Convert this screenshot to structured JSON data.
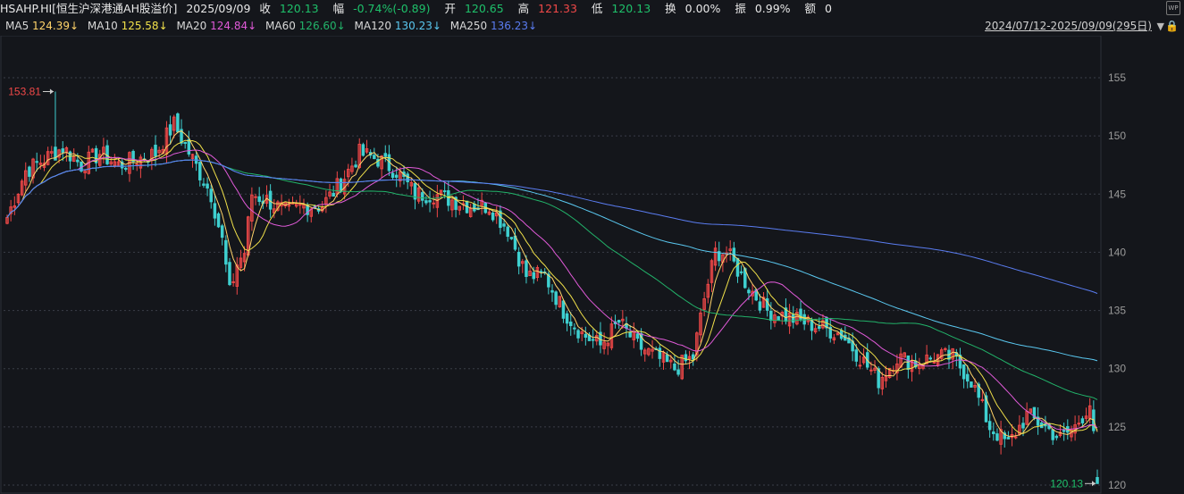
{
  "header": {
    "symbol": "HSAHP.HI[恒生沪深港通AH股溢价]",
    "date": "2025/09/09",
    "close_label": "收",
    "close": "120.13",
    "change_label": "幅",
    "change": "-0.74%(-0.89)",
    "open_label": "开",
    "open": "120.65",
    "high_label": "高",
    "high": "121.33",
    "low_label": "低",
    "low": "120.13",
    "turnover_label": "换",
    "turnover": "0.00%",
    "amplitude_label": "振",
    "amplitude": "0.99%",
    "amount_label": "额",
    "amount": "0"
  },
  "ma_legend": [
    {
      "name": "MA5",
      "value": "124.39↓",
      "color": "#ffd36a"
    },
    {
      "name": "MA10",
      "value": "125.58↓",
      "color": "#f0e04a"
    },
    {
      "name": "MA20",
      "value": "124.84↓",
      "color": "#e05ad8"
    },
    {
      "name": "MA60",
      "value": "126.60↓",
      "color": "#22b36a"
    },
    {
      "name": "MA120",
      "value": "130.23↓",
      "color": "#5ac8f0"
    },
    {
      "name": "MA250",
      "value": "136.23↓",
      "color": "#5a7cf0"
    }
  ],
  "range_text": "2024/07/12-2025/09/09(295日)",
  "colors": {
    "up": "#f04848",
    "down": "#3fd0d0",
    "grid": "#3a3e48",
    "axis_text": "#9a9a9a"
  },
  "chart_data": {
    "type": "candlestick",
    "title": "HSAHP.HI[恒生沪深港通AH股溢价]",
    "x_range": [
      "2024/07/12",
      "2025/09/09"
    ],
    "trading_days": 295,
    "ylim": [
      120,
      156
    ],
    "y_ticks": [
      120,
      125,
      130,
      135,
      140,
      145,
      150,
      155
    ],
    "grid": "horizontal-dashed",
    "annotations": [
      {
        "text": "153.81",
        "index": 13,
        "value": 153.81,
        "color": "#f04848"
      },
      {
        "text": "120.13",
        "index": 294,
        "value": 120.13,
        "color": "#1ec06a"
      }
    ],
    "anchors": [
      [
        0,
        143
      ],
      [
        5,
        147
      ],
      [
        10,
        148
      ],
      [
        15,
        149
      ],
      [
        20,
        147.5
      ],
      [
        25,
        148.5
      ],
      [
        30,
        147.5
      ],
      [
        35,
        148
      ],
      [
        40,
        148.5
      ],
      [
        45,
        151
      ],
      [
        50,
        148
      ],
      [
        55,
        145
      ],
      [
        58,
        141
      ],
      [
        60,
        136.5
      ],
      [
        62,
        139
      ],
      [
        64,
        140
      ],
      [
        66,
        145
      ],
      [
        70,
        144.5
      ],
      [
        75,
        143.5
      ],
      [
        80,
        144
      ],
      [
        85,
        144
      ],
      [
        90,
        146
      ],
      [
        95,
        148.5
      ],
      [
        100,
        148
      ],
      [
        105,
        147
      ],
      [
        110,
        145
      ],
      [
        115,
        145
      ],
      [
        120,
        144.5
      ],
      [
        125,
        144
      ],
      [
        130,
        144
      ],
      [
        135,
        142
      ],
      [
        140,
        138
      ],
      [
        145,
        138
      ],
      [
        150,
        135
      ],
      [
        155,
        133
      ],
      [
        160,
        132
      ],
      [
        165,
        134
      ],
      [
        170,
        132
      ],
      [
        175,
        131
      ],
      [
        180,
        130
      ],
      [
        185,
        131
      ],
      [
        188,
        136
      ],
      [
        191,
        140
      ],
      [
        194,
        140
      ],
      [
        197,
        138.5
      ],
      [
        200,
        137
      ],
      [
        205,
        135
      ],
      [
        210,
        134.5
      ],
      [
        215,
        134
      ],
      [
        220,
        133.5
      ],
      [
        225,
        133
      ],
      [
        230,
        131
      ],
      [
        235,
        129
      ],
      [
        240,
        131
      ],
      [
        245,
        130.5
      ],
      [
        250,
        131
      ],
      [
        255,
        131
      ],
      [
        260,
        129
      ],
      [
        265,
        125
      ],
      [
        270,
        123.5
      ],
      [
        275,
        126
      ],
      [
        280,
        125
      ],
      [
        284,
        124
      ],
      [
        288,
        125
      ],
      [
        292,
        127
      ],
      [
        294,
        121
      ]
    ],
    "series": [
      {
        "name": "MA5",
        "values": "moving average of close, 5 periods",
        "last": "124.39"
      },
      {
        "name": "MA10",
        "values": "moving average of close, 10 periods",
        "last": "125.58"
      },
      {
        "name": "MA20",
        "values": "moving average of close, 20 periods",
        "last": "124.84"
      },
      {
        "name": "MA60",
        "values": "moving average of close, 60 periods",
        "last": "126.60"
      },
      {
        "name": "MA120",
        "values": "moving average of close, 120 periods",
        "last": "130.23"
      },
      {
        "name": "MA250",
        "values": "moving average of close, 250 periods",
        "last": "136.23"
      }
    ]
  }
}
